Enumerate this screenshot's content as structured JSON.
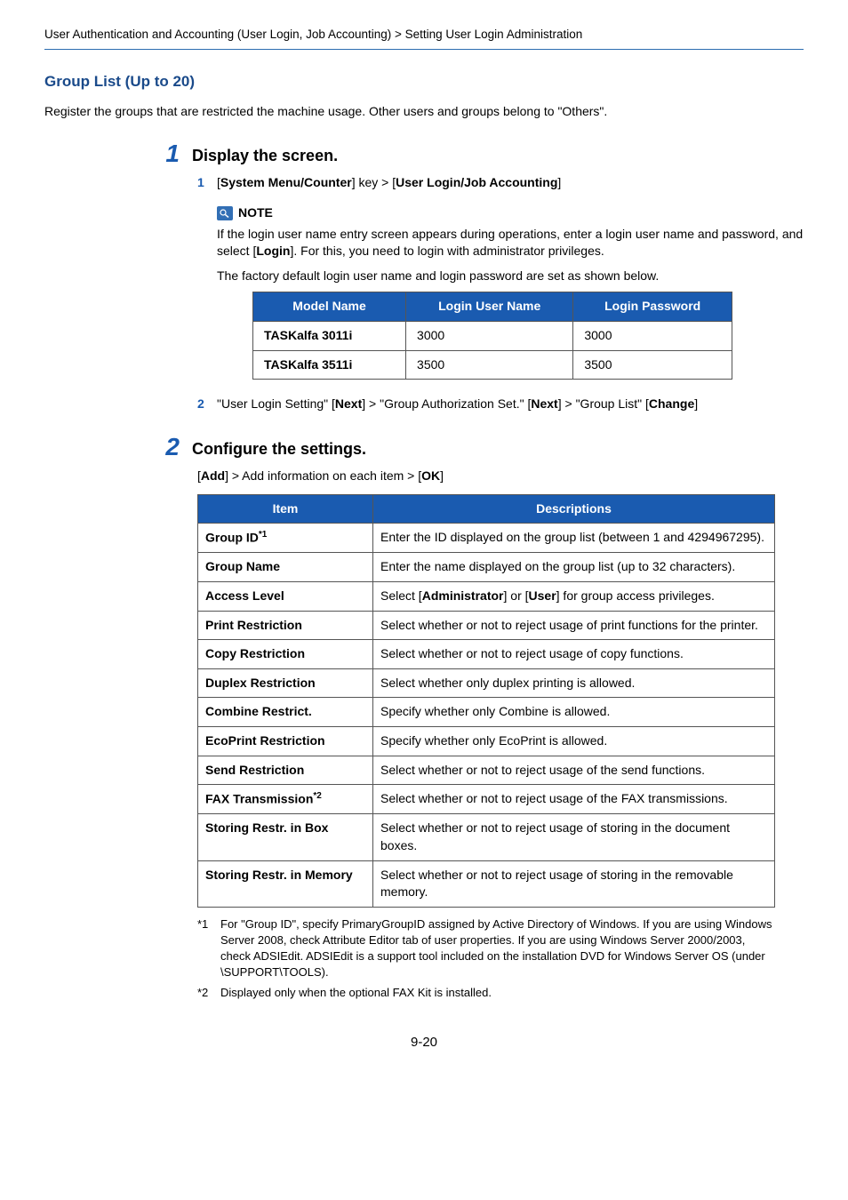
{
  "header": {
    "breadcrumb": "User Authentication and Accounting (User Login, Job Accounting) > Setting User Login Administration"
  },
  "section": {
    "title": "Group List (Up to 20)",
    "intro": "Register the groups that are restricted the machine usage. Other users and groups belong to \"Others\"."
  },
  "step1": {
    "num": "1",
    "heading": "Display the screen.",
    "sub1": {
      "num": "1",
      "prefix": "[",
      "k1": "System Menu/Counter",
      "mid": "] key > [",
      "k2": "User Login/Job Accounting",
      "suffix": "]"
    },
    "note": {
      "label": "NOTE",
      "p1a": "If the login user name entry screen appears during operations, enter a login user name and password, and select [",
      "p1b": "Login",
      "p1c": "]. For this, you need to login with administrator privileges.",
      "p2": "The factory default login user name and login password are set as shown below."
    },
    "model_table": {
      "h1": "Model Name",
      "h2": "Login User Name",
      "h3": "Login Password",
      "rows": [
        {
          "m": "TASKalfa 3011i",
          "u": "3000",
          "p": "3000"
        },
        {
          "m": "TASKalfa 3511i",
          "u": "3500",
          "p": "3500"
        }
      ]
    },
    "sub2": {
      "num": "2",
      "t0": "\"User Login Setting\" [",
      "t1": "Next",
      "t2": "] > \"Group Authorization Set.\" [",
      "t3": "Next",
      "t4": "] > \"Group List\" [",
      "t5": "Change",
      "t6": "]"
    }
  },
  "step2": {
    "num": "2",
    "heading": "Configure the settings.",
    "line": {
      "a": "[",
      "b": "Add",
      "c": "] > Add information on each item > [",
      "d": "OK",
      "e": "]"
    },
    "items_table": {
      "h1": "Item",
      "h2": "Descriptions",
      "rows": [
        {
          "item": "Group ID",
          "sup": "*1",
          "desc": "Enter the ID displayed on the group list (between 1 and 4294967295)."
        },
        {
          "item": "Group Name",
          "sup": "",
          "desc": "Enter the name displayed on the group list (up to 32 characters)."
        },
        {
          "item": "Access Level",
          "sup": "",
          "desc_pre": "Select [",
          "b1": "Administrator",
          "mid": "] or [",
          "b2": "User",
          "desc_post": "] for group access privileges."
        },
        {
          "item": "Print Restriction",
          "sup": "",
          "desc": "Select whether or not to reject usage of print functions for the printer."
        },
        {
          "item": "Copy Restriction",
          "sup": "",
          "desc": "Select whether or not to reject usage of copy functions."
        },
        {
          "item": "Duplex Restriction",
          "sup": "",
          "desc": "Select whether only duplex printing is allowed."
        },
        {
          "item": "Combine Restrict.",
          "sup": "",
          "desc": "Specify whether only Combine is allowed."
        },
        {
          "item": "EcoPrint Restriction",
          "sup": "",
          "desc": "Specify whether only EcoPrint is allowed."
        },
        {
          "item": "Send Restriction",
          "sup": "",
          "desc": "Select whether or not to reject usage of the send functions."
        },
        {
          "item": "FAX Transmission",
          "sup": "*2",
          "desc": "Select whether or not to reject usage of the FAX transmissions."
        },
        {
          "item": "Storing Restr. in Box",
          "sup": "",
          "desc": "Select whether or not to reject usage of storing in the document boxes."
        },
        {
          "item": "Storing Restr. in Memory",
          "sup": "",
          "desc": "Select whether or not to reject usage of storing in the removable memory."
        }
      ]
    },
    "footnotes": {
      "f1": {
        "mark": "*1",
        "text": "For \"Group ID\", specify PrimaryGroupID assigned by Active Directory of Windows. If you are using Windows Server 2008, check Attribute Editor tab of user properties. If you are using Windows Server 2000/2003, check ADSIEdit. ADSIEdit is a support tool included on the installation DVD for Windows Server OS (under \\SUPPORT\\TOOLS)."
      },
      "f2": {
        "mark": "*2",
        "text": "Displayed only when the optional FAX Kit is installed."
      }
    }
  },
  "page_number": "9-20"
}
